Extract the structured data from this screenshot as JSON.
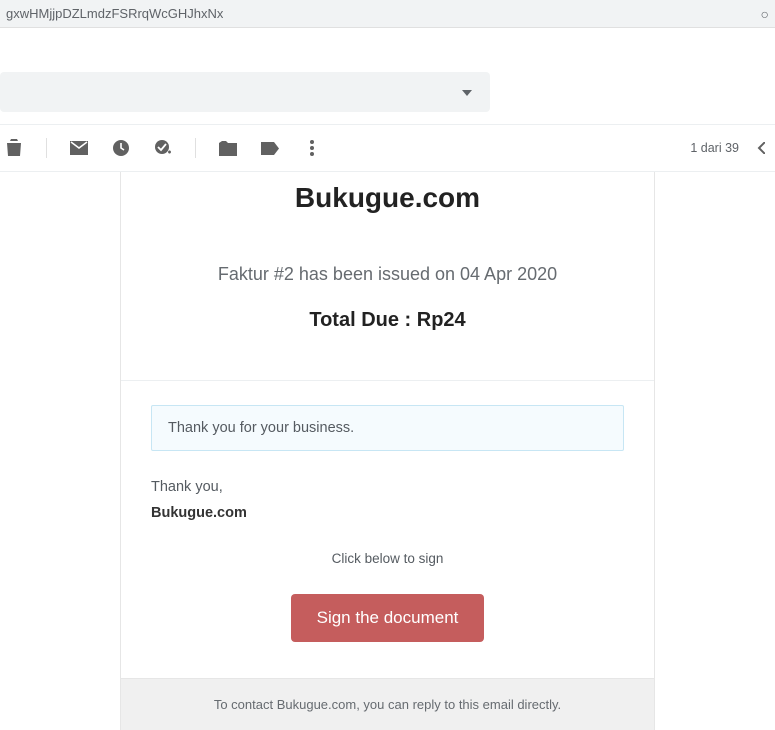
{
  "url_fragment": "gxwHMjjpDZLmdzFSRrqWcGHJhxNx",
  "pagination": "1 dari 39",
  "mail": {
    "brand": "Bukugue.com",
    "issued_line": "Faktur #2 has been issued on 04 Apr 2020",
    "total_due_line": "Total Due : Rp24",
    "thank_box": "Thank you for your business.",
    "thank_you": "Thank you,",
    "sender": "Bukugue.com",
    "click_below": "Click below to sign",
    "sign_button": "Sign the document",
    "footer": "To contact Bukugue.com, you can reply to this email directly."
  }
}
